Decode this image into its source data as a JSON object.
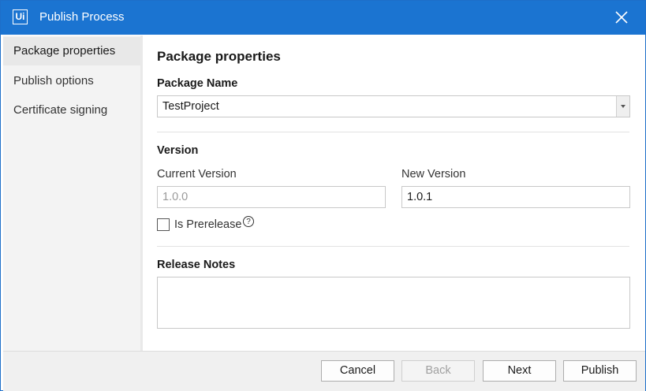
{
  "window": {
    "app_logo": "Ui",
    "title": "Publish Process",
    "close_icon": "close-icon"
  },
  "sidebar": {
    "items": [
      {
        "label": "Package properties",
        "active": true
      },
      {
        "label": "Publish options",
        "active": false
      },
      {
        "label": "Certificate signing",
        "active": false
      }
    ]
  },
  "main": {
    "heading": "Package properties",
    "package_name_label": "Package Name",
    "package_name_value": "TestProject",
    "version_label": "Version",
    "current_version_label": "Current Version",
    "current_version_value": "1.0.0",
    "new_version_label": "New Version",
    "new_version_value": "1.0.1",
    "prerelease_label": "Is Prerelease",
    "prerelease_checked": false,
    "help_glyph": "?",
    "release_notes_label": "Release Notes",
    "release_notes_value": ""
  },
  "footer": {
    "cancel_label": "Cancel",
    "back_label": "Back",
    "next_label": "Next",
    "publish_label": "Publish"
  },
  "colors": {
    "title_bar": "#1b74d1",
    "sidebar_bg": "#f3f3f3",
    "footer_bg": "#f0f0f0"
  }
}
